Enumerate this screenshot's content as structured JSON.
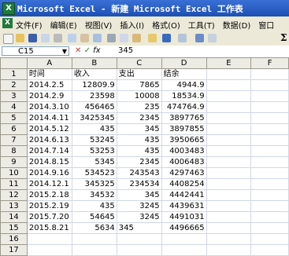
{
  "window": {
    "title": "Microsoft Excel - 新建 Microsoft Excel 工作表",
    "app_icon": "excel-icon"
  },
  "menu": [
    "文件(F)",
    "编辑(E)",
    "视图(V)",
    "插入(I)",
    "格式(O)",
    "工具(T)",
    "数据(D)",
    "窗口"
  ],
  "formula_bar": {
    "cell": "C15",
    "value": "345"
  },
  "columns": [
    "A",
    "B",
    "C",
    "D",
    "E",
    "F"
  ],
  "rows": [
    {
      "n": "1",
      "a": "时间",
      "b": "收入",
      "c": "支出",
      "d": "结余"
    },
    {
      "n": "2",
      "a": "2014.2.5",
      "b": "12809.9",
      "c": "7865",
      "d": "4944.9"
    },
    {
      "n": "3",
      "a": "2014.2.9",
      "b": "23598",
      "c": "10008",
      "d": "18534.9"
    },
    {
      "n": "4",
      "a": "2014.3.10",
      "b": "456465",
      "c": "235",
      "d": "474764.9"
    },
    {
      "n": "5",
      "a": "2014.4.11",
      "b": "3425345",
      "c": "2345",
      "d": "3897765"
    },
    {
      "n": "6",
      "a": "2014.5.12",
      "b": "435",
      "c": "345",
      "d": "3897855"
    },
    {
      "n": "7",
      "a": "2014.6.13",
      "b": "53245",
      "c": "435",
      "d": "3950665"
    },
    {
      "n": "8",
      "a": "2014.7.14",
      "b": "53253",
      "c": "435",
      "d": "4003483"
    },
    {
      "n": "9",
      "a": "2014.8.15",
      "b": "5345",
      "c": "2345",
      "d": "4006483"
    },
    {
      "n": "10",
      "a": "2014.9.16",
      "b": "534523",
      "c": "243543",
      "d": "4297463"
    },
    {
      "n": "11",
      "a": "2014.12.1",
      "b": "345325",
      "c": "234534",
      "d": "4408254"
    },
    {
      "n": "12",
      "a": "2015.2.18",
      "b": "34532",
      "c": "345",
      "d": "4442441"
    },
    {
      "n": "13",
      "a": "2015.2.19",
      "b": "435",
      "c": "3245",
      "d": "4439631"
    },
    {
      "n": "14",
      "a": "2015.7.20",
      "b": "54645",
      "c": "3245",
      "d": "4491031"
    },
    {
      "n": "15",
      "a": "2015.8.21",
      "b": "5634",
      "c": "345",
      "d": "4496665"
    },
    {
      "n": "16",
      "a": "",
      "b": "",
      "c": "",
      "d": ""
    },
    {
      "n": "17",
      "a": "",
      "b": "",
      "c": "",
      "d": ""
    }
  ]
}
